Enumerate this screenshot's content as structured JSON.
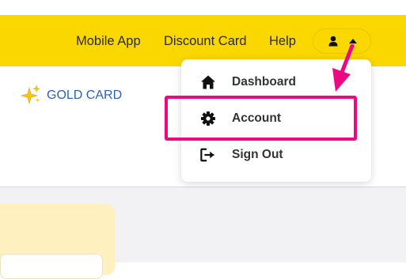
{
  "header": {
    "nav": [
      {
        "label": "Mobile App"
      },
      {
        "label": "Discount Card"
      },
      {
        "label": "Help"
      }
    ],
    "user_menu": {
      "icon": "user-icon",
      "toggle_icon": "caret-up-icon"
    }
  },
  "promo": {
    "label": "GOLD CARD",
    "icon": "sparkle-icon"
  },
  "dropdown": {
    "items": [
      {
        "label": "Dashboard",
        "icon": "home-icon"
      },
      {
        "label": "Account",
        "icon": "gear-icon"
      },
      {
        "label": "Sign Out",
        "icon": "sign-out-icon"
      }
    ]
  },
  "annotation": {
    "color": "#ec0a84"
  },
  "colors": {
    "header_bg": "#fbd700",
    "link_blue": "#2f5fb6",
    "card_yellow": "#fff1bf"
  }
}
